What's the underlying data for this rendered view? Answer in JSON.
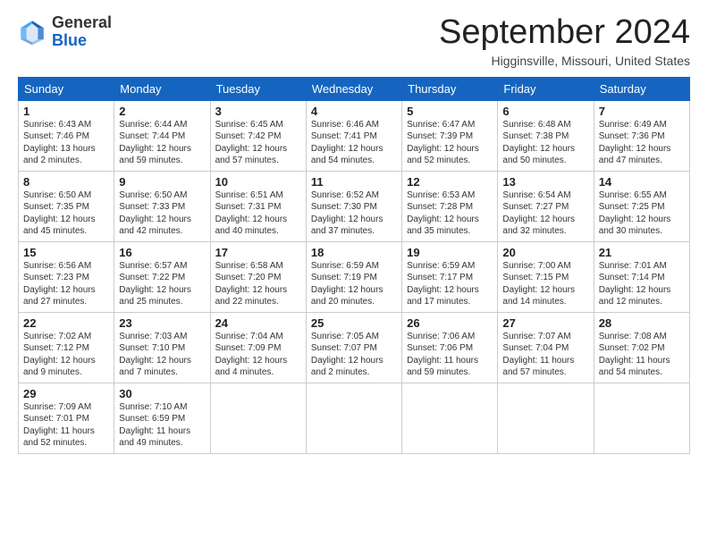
{
  "header": {
    "logo_general": "General",
    "logo_blue": "Blue",
    "month_title": "September 2024",
    "location": "Higginsville, Missouri, United States"
  },
  "weekdays": [
    "Sunday",
    "Monday",
    "Tuesday",
    "Wednesday",
    "Thursday",
    "Friday",
    "Saturday"
  ],
  "weeks": [
    [
      {
        "day": "1",
        "info": "Sunrise: 6:43 AM\nSunset: 7:46 PM\nDaylight: 13 hours\nand 2 minutes."
      },
      {
        "day": "2",
        "info": "Sunrise: 6:44 AM\nSunset: 7:44 PM\nDaylight: 12 hours\nand 59 minutes."
      },
      {
        "day": "3",
        "info": "Sunrise: 6:45 AM\nSunset: 7:42 PM\nDaylight: 12 hours\nand 57 minutes."
      },
      {
        "day": "4",
        "info": "Sunrise: 6:46 AM\nSunset: 7:41 PM\nDaylight: 12 hours\nand 54 minutes."
      },
      {
        "day": "5",
        "info": "Sunrise: 6:47 AM\nSunset: 7:39 PM\nDaylight: 12 hours\nand 52 minutes."
      },
      {
        "day": "6",
        "info": "Sunrise: 6:48 AM\nSunset: 7:38 PM\nDaylight: 12 hours\nand 50 minutes."
      },
      {
        "day": "7",
        "info": "Sunrise: 6:49 AM\nSunset: 7:36 PM\nDaylight: 12 hours\nand 47 minutes."
      }
    ],
    [
      {
        "day": "8",
        "info": "Sunrise: 6:50 AM\nSunset: 7:35 PM\nDaylight: 12 hours\nand 45 minutes."
      },
      {
        "day": "9",
        "info": "Sunrise: 6:50 AM\nSunset: 7:33 PM\nDaylight: 12 hours\nand 42 minutes."
      },
      {
        "day": "10",
        "info": "Sunrise: 6:51 AM\nSunset: 7:31 PM\nDaylight: 12 hours\nand 40 minutes."
      },
      {
        "day": "11",
        "info": "Sunrise: 6:52 AM\nSunset: 7:30 PM\nDaylight: 12 hours\nand 37 minutes."
      },
      {
        "day": "12",
        "info": "Sunrise: 6:53 AM\nSunset: 7:28 PM\nDaylight: 12 hours\nand 35 minutes."
      },
      {
        "day": "13",
        "info": "Sunrise: 6:54 AM\nSunset: 7:27 PM\nDaylight: 12 hours\nand 32 minutes."
      },
      {
        "day": "14",
        "info": "Sunrise: 6:55 AM\nSunset: 7:25 PM\nDaylight: 12 hours\nand 30 minutes."
      }
    ],
    [
      {
        "day": "15",
        "info": "Sunrise: 6:56 AM\nSunset: 7:23 PM\nDaylight: 12 hours\nand 27 minutes."
      },
      {
        "day": "16",
        "info": "Sunrise: 6:57 AM\nSunset: 7:22 PM\nDaylight: 12 hours\nand 25 minutes."
      },
      {
        "day": "17",
        "info": "Sunrise: 6:58 AM\nSunset: 7:20 PM\nDaylight: 12 hours\nand 22 minutes."
      },
      {
        "day": "18",
        "info": "Sunrise: 6:59 AM\nSunset: 7:19 PM\nDaylight: 12 hours\nand 20 minutes."
      },
      {
        "day": "19",
        "info": "Sunrise: 6:59 AM\nSunset: 7:17 PM\nDaylight: 12 hours\nand 17 minutes."
      },
      {
        "day": "20",
        "info": "Sunrise: 7:00 AM\nSunset: 7:15 PM\nDaylight: 12 hours\nand 14 minutes."
      },
      {
        "day": "21",
        "info": "Sunrise: 7:01 AM\nSunset: 7:14 PM\nDaylight: 12 hours\nand 12 minutes."
      }
    ],
    [
      {
        "day": "22",
        "info": "Sunrise: 7:02 AM\nSunset: 7:12 PM\nDaylight: 12 hours\nand 9 minutes."
      },
      {
        "day": "23",
        "info": "Sunrise: 7:03 AM\nSunset: 7:10 PM\nDaylight: 12 hours\nand 7 minutes."
      },
      {
        "day": "24",
        "info": "Sunrise: 7:04 AM\nSunset: 7:09 PM\nDaylight: 12 hours\nand 4 minutes."
      },
      {
        "day": "25",
        "info": "Sunrise: 7:05 AM\nSunset: 7:07 PM\nDaylight: 12 hours\nand 2 minutes."
      },
      {
        "day": "26",
        "info": "Sunrise: 7:06 AM\nSunset: 7:06 PM\nDaylight: 11 hours\nand 59 minutes."
      },
      {
        "day": "27",
        "info": "Sunrise: 7:07 AM\nSunset: 7:04 PM\nDaylight: 11 hours\nand 57 minutes."
      },
      {
        "day": "28",
        "info": "Sunrise: 7:08 AM\nSunset: 7:02 PM\nDaylight: 11 hours\nand 54 minutes."
      }
    ],
    [
      {
        "day": "29",
        "info": "Sunrise: 7:09 AM\nSunset: 7:01 PM\nDaylight: 11 hours\nand 52 minutes."
      },
      {
        "day": "30",
        "info": "Sunrise: 7:10 AM\nSunset: 6:59 PM\nDaylight: 11 hours\nand 49 minutes."
      },
      {
        "day": "",
        "info": ""
      },
      {
        "day": "",
        "info": ""
      },
      {
        "day": "",
        "info": ""
      },
      {
        "day": "",
        "info": ""
      },
      {
        "day": "",
        "info": ""
      }
    ]
  ]
}
